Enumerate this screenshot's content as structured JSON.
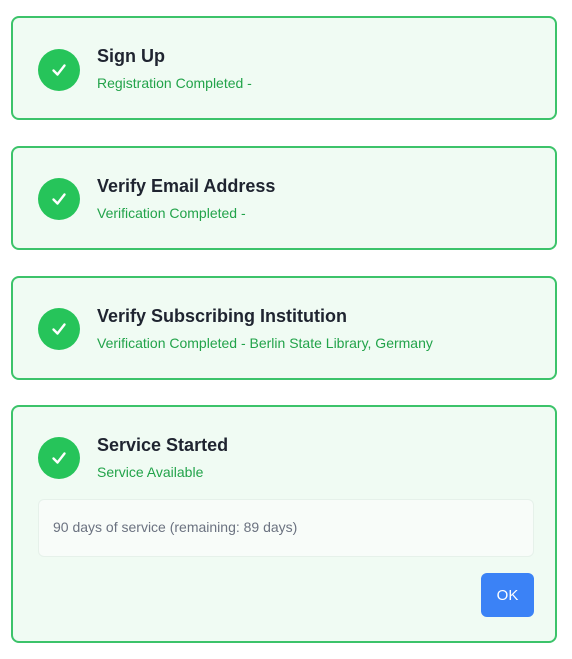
{
  "steps": [
    {
      "title": "Sign Up",
      "status": "Registration Completed -"
    },
    {
      "title": "Verify Email Address",
      "status": "Verification Completed -"
    },
    {
      "title": "Verify Subscribing Institution",
      "status": "Verification Completed - Berlin State Library, Germany"
    },
    {
      "title": "Service Started",
      "status": "Service Available",
      "info": "90 days of service (remaining: 89 days)",
      "ok_label": "OK"
    }
  ],
  "icons": {
    "step_icon": "check-icon"
  },
  "colors": {
    "card_border": "#3cc36a",
    "card_background": "#f0fbf3",
    "check_circle": "#26c45a",
    "status_text": "#22a34a",
    "title_text": "#1f2430",
    "button": "#3b82f6"
  }
}
